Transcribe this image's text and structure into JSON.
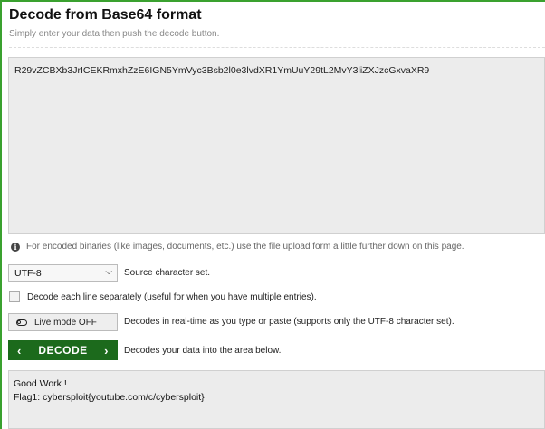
{
  "header": {
    "title": "Decode from Base64 format",
    "subtitle": "Simply enter your data then push the decode button."
  },
  "input": {
    "value": "R29vZCBXb3JrICEKRmxhZzE6IGN5YmVyc3Bsb2l0e3lvdXR1YmUuY29tL2MvY3liZXJzcGxvaXR9"
  },
  "info": {
    "icon": "info-icon",
    "text": "For encoded binaries (like images, documents, etc.) use the file upload form a little further down on this page."
  },
  "charset": {
    "selected": "UTF-8",
    "label": "Source character set."
  },
  "separate_lines": {
    "checked": false,
    "label": "Decode each line separately (useful for when you have multiple entries)."
  },
  "live_mode": {
    "button_label": "Live mode OFF",
    "description": "Decodes in real-time as you type or paste (supports only the UTF-8 character set)."
  },
  "decode": {
    "button_label": "DECODE",
    "description": "Decodes your data into the area below."
  },
  "output": {
    "line1": "Good Work !",
    "line2": "Flag1: cybersploit{youtube.com/c/cybersploit}"
  },
  "colors": {
    "accent": "#3aa12f",
    "button": "#1c6a1c",
    "field_bg": "#ececec"
  }
}
